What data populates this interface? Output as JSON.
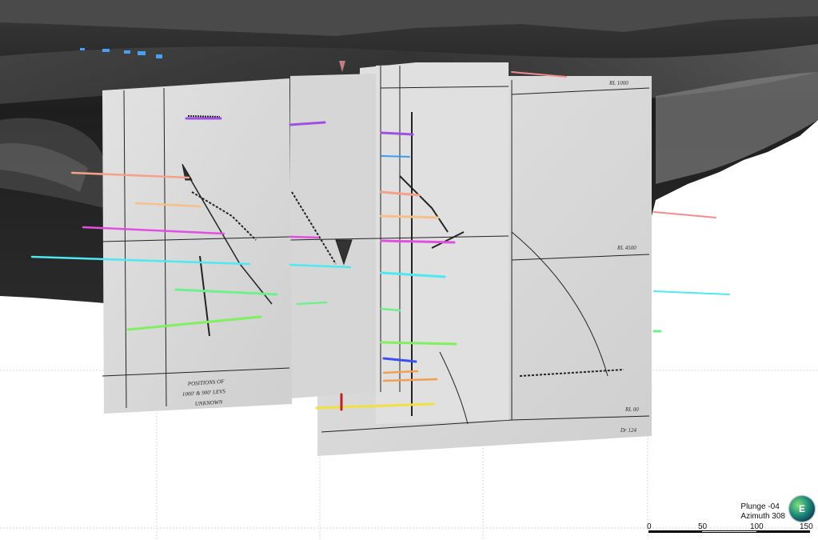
{
  "view": {
    "orientation": {
      "plunge_label": "Plunge -04",
      "azimuth_label": "Azimuth 308"
    },
    "compass": {
      "letter": "E",
      "icon": "globe-compass-icon"
    },
    "scale_bar": {
      "labels": [
        "0",
        "50",
        "100",
        "150"
      ]
    }
  },
  "sheets": {
    "left": {
      "annotation_1": "POSITIONS OF",
      "annotation_2": "1000' & 900' LEVS",
      "annotation_3": "UNKNOWN"
    },
    "right": {
      "rl_top": "RL 1000",
      "rl_mid": "RL 4500",
      "rl_bottom": "RL 00",
      "corner_note": "Dr 124"
    }
  },
  "colors": {
    "terrain_dark": "#262626",
    "paper": "#dcdcdc",
    "pink": "#f08c8c",
    "salmon": "#f5a08c",
    "peach": "#f5c08c",
    "magenta": "#e050e0",
    "cyan": "#4de8f0",
    "green": "#6ef08c",
    "lime": "#80f060",
    "blue": "#3c78f0",
    "yellow": "#f0e040",
    "orange": "#f0a050",
    "purple": "#a050e0",
    "red": "#c02020"
  }
}
